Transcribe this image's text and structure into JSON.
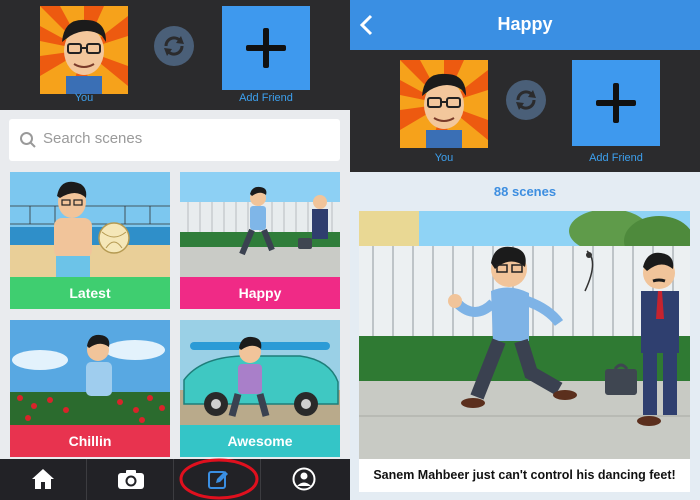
{
  "left": {
    "friend_bar": {
      "you_label": "You",
      "add_friend_label": "Add Friend"
    },
    "search": {
      "placeholder": "Search scenes"
    },
    "scenes": [
      {
        "label": "Latest",
        "color": "#3fce70"
      },
      {
        "label": "Happy",
        "color": "#f02a86"
      },
      {
        "label": "Chillin",
        "color": "#e8334f"
      },
      {
        "label": "Awesome",
        "color": "#34c5c7"
      }
    ],
    "nav": [
      "home-icon",
      "camera-icon",
      "edit-icon",
      "profile-icon"
    ],
    "active_nav": "edit-icon"
  },
  "right": {
    "header": {
      "title": "Happy"
    },
    "friend_bar": {
      "you_label": "You",
      "add_friend_label": "Add Friend"
    },
    "scene_count": "88 scenes",
    "scene_caption": "Sanem Mahbeer just can't control his dancing feet!"
  },
  "colors": {
    "accent": "#3a8fe3",
    "dark_bar": "#2b2b2d",
    "highlight_ring": "#e0101e"
  }
}
